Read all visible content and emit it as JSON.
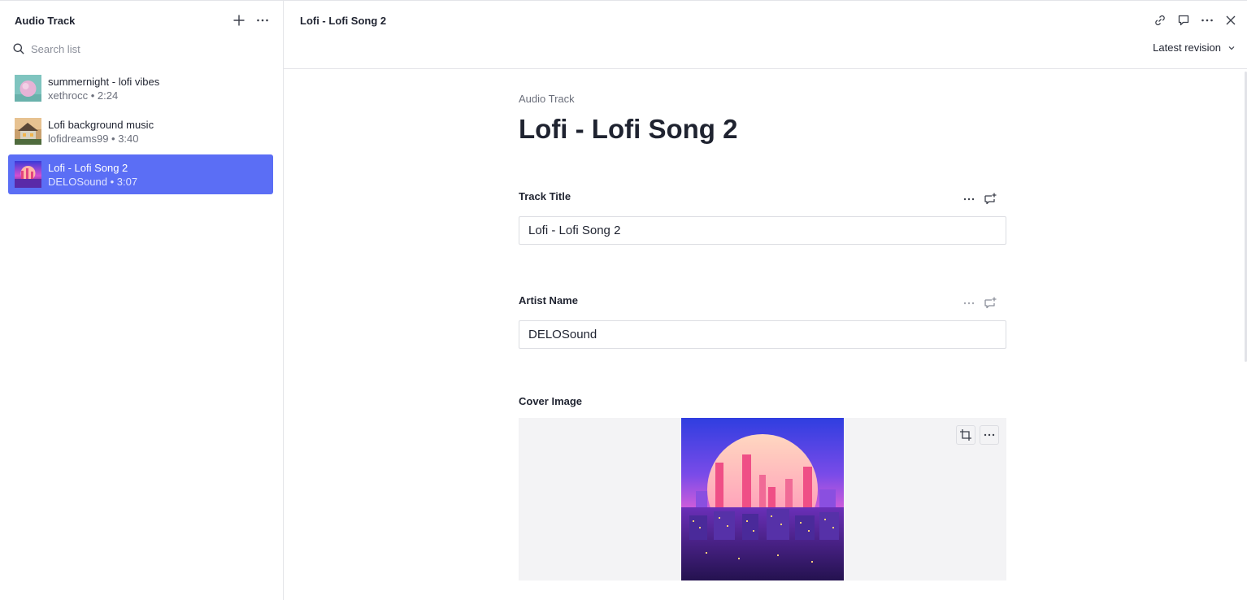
{
  "sidebar": {
    "title": "Audio Track",
    "search": {
      "placeholder": "Search list",
      "value": ""
    },
    "items": [
      {
        "title": "summernight - lofi vibes",
        "subtitle": "xethrocc • 2:24",
        "selected": false
      },
      {
        "title": "Lofi background music",
        "subtitle": "lofidreams99 • 3:40",
        "selected": false
      },
      {
        "title": "Lofi - Lofi Song 2",
        "subtitle": "DELOSound • 3:07",
        "selected": true
      }
    ]
  },
  "header": {
    "title": "Lofi - Lofi Song 2",
    "revision_label": "Latest revision",
    "icons": [
      "link-icon",
      "comment-icon",
      "more-icon",
      "close-icon"
    ]
  },
  "document": {
    "type": "Audio Track",
    "heading": "Lofi - Lofi Song 2",
    "fields": {
      "track_title": {
        "label": "Track Title",
        "value": "Lofi - Lofi Song 2"
      },
      "artist_name": {
        "label": "Artist Name",
        "value": "DELOSound"
      },
      "cover_image": {
        "label": "Cover Image"
      }
    }
  },
  "colors": {
    "accent": "#5b6ef5",
    "border": "#e3e4e8",
    "text": "#1f2330",
    "muted": "#6b6f7b"
  }
}
